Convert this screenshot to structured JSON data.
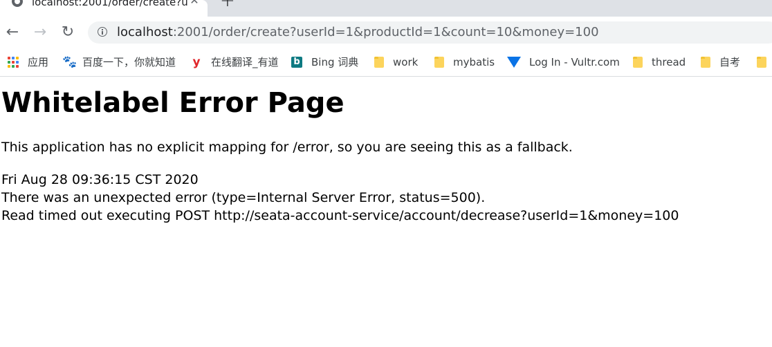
{
  "browser": {
    "tab_title": "localhost:2001/order/create?u",
    "url_host": "localhost",
    "url_rest": ":2001/order/create?userId=1&productId=1&count=10&money=100"
  },
  "bookmarks": [
    {
      "label": "应用",
      "icon": "apps-icon"
    },
    {
      "label": "百度一下，你就知道",
      "icon": "baidu-paw-icon"
    },
    {
      "label": "在线翻译_有道",
      "icon": "youdao-icon"
    },
    {
      "label": "Bing 词典",
      "icon": "bing-icon"
    },
    {
      "label": "work",
      "icon": "folder-icon"
    },
    {
      "label": "mybatis",
      "icon": "folder-icon"
    },
    {
      "label": "Log In - Vultr.com",
      "icon": "vultr-icon"
    },
    {
      "label": "thread",
      "icon": "folder-icon"
    },
    {
      "label": "自考",
      "icon": "folder-icon"
    }
  ],
  "page": {
    "title": "Whitelabel Error Page",
    "explanation": "This application has no explicit mapping for /error, so you are seeing this as a fallback.",
    "timestamp": "Fri Aug 28 09:36:15 CST 2020",
    "error_line": "There was an unexpected error (type=Internal Server Error, status=500).",
    "message": "Read timed out executing POST http://seata-account-service/account/decrease?userId=1&money=100"
  }
}
